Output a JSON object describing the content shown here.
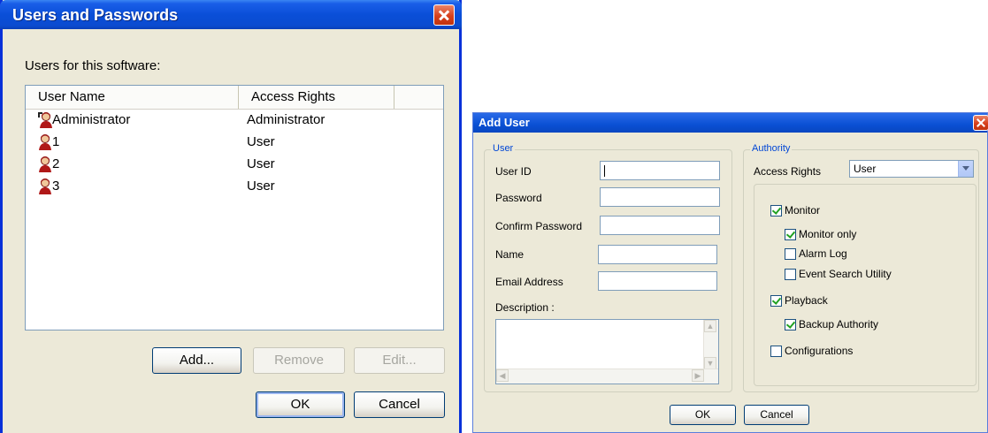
{
  "users_window": {
    "title": "Users and Passwords",
    "label": "Users for this software:",
    "columns": [
      "User Name",
      "Access Rights"
    ],
    "rows": [
      {
        "name": "Administrator",
        "rights": "Administrator",
        "icon": "admin-user-icon"
      },
      {
        "name": "1",
        "rights": "User",
        "icon": "user-icon"
      },
      {
        "name": "2",
        "rights": "User",
        "icon": "user-icon"
      },
      {
        "name": "3",
        "rights": "User",
        "icon": "user-icon"
      }
    ],
    "buttons": {
      "add": "Add...",
      "remove": "Remove",
      "edit": "Edit...",
      "ok": "OK",
      "cancel": "Cancel"
    }
  },
  "add_user_window": {
    "title": "Add User",
    "user_group": {
      "title": "User",
      "user_id_label": "User ID",
      "password_label": "Password",
      "confirm_password_label": "Confirm Password",
      "name_label": "Name",
      "email_label": "Email Address",
      "description_label": "Description :"
    },
    "authority_group": {
      "title": "Authority",
      "access_rights_label": "Access Rights",
      "access_rights_value": "User",
      "checks": {
        "monitor": {
          "label": "Monitor",
          "checked": true
        },
        "monitor_only": {
          "label": "Monitor only",
          "checked": true
        },
        "alarm_log": {
          "label": "Alarm Log",
          "checked": false
        },
        "event_search": {
          "label": "Event Search Utility",
          "checked": false
        },
        "playback": {
          "label": "Playback",
          "checked": true
        },
        "backup_authority": {
          "label": "Backup Authority",
          "checked": true
        },
        "configurations": {
          "label": "Configurations",
          "checked": false
        }
      }
    },
    "buttons": {
      "ok": "OK",
      "cancel": "Cancel"
    }
  },
  "colors": {
    "title_blue": "#0a4fd8",
    "dialog_bg": "#ece9d8",
    "close_red": "#d8401c",
    "group_title": "#0046d5"
  }
}
